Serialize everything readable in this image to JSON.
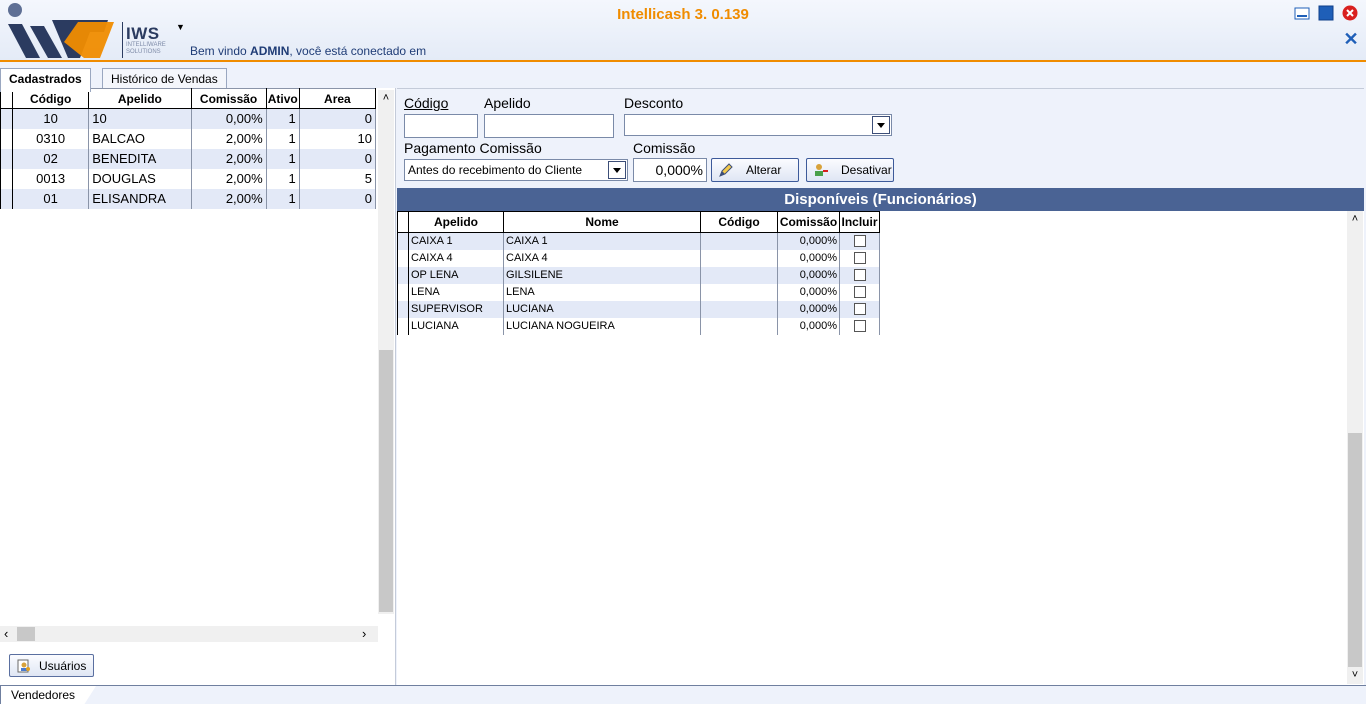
{
  "app": {
    "title": "Intellicash 3. 0.139",
    "logo_text": "IWS",
    "logo_subtitle": "INTELLIWARE SOLUTIONS",
    "welcome_prefix": "Bem vindo ",
    "welcome_user": "ADMIN",
    "welcome_suffix": ", você está conectado em",
    "accent_color": "#f08c00",
    "brand_color": "#4a6394"
  },
  "tabs": [
    {
      "label": "Cadastrados",
      "active": true
    },
    {
      "label": "Histórico de Vendas",
      "active": false
    }
  ],
  "left_table": {
    "columns": [
      "Código",
      "Apelido",
      "Comissão",
      "Ativo",
      "Area"
    ],
    "rows": [
      {
        "codigo": "10",
        "apelido": "10",
        "comissao": "0,00%",
        "ativo": "1",
        "area": "0"
      },
      {
        "codigo": "0310",
        "apelido": "BALCAO",
        "comissao": "2,00%",
        "ativo": "1",
        "area": "10"
      },
      {
        "codigo": "02",
        "apelido": "BENEDITA",
        "comissao": "2,00%",
        "ativo": "1",
        "area": "0"
      },
      {
        "codigo": "0013",
        "apelido": "DOUGLAS",
        "comissao": "2,00%",
        "ativo": "1",
        "area": "5"
      },
      {
        "codigo": "01",
        "apelido": "ELISANDRA",
        "comissao": "2,00%",
        "ativo": "1",
        "area": "0"
      }
    ]
  },
  "usuarios_button": {
    "label": "Usuários"
  },
  "form": {
    "codigo_label": "Código",
    "codigo_value": "",
    "apelido_label": "Apelido",
    "apelido_value": "",
    "desconto_label": "Desconto",
    "desconto_value": "",
    "pagamento_label": "Pagamento Comissão",
    "pagamento_value": "Antes do recebimento do Cliente",
    "comissao_label": "Comissão",
    "comissao_value": "0,000%",
    "alterar_label": "Alterar",
    "desativar_label": "Desativar"
  },
  "disponiveis": {
    "title": "Disponíveis (Funcionários)",
    "columns": [
      "Apelido",
      "Nome",
      "Código",
      "Comissão",
      "Incluir"
    ],
    "rows": [
      {
        "apelido": "CAIXA 1",
        "nome": "CAIXA 1",
        "codigo": "",
        "comissao": "0,000%",
        "incluir": false
      },
      {
        "apelido": "CAIXA 4",
        "nome": "CAIXA 4",
        "codigo": "",
        "comissao": "0,000%",
        "incluir": false
      },
      {
        "apelido": "OP LENA",
        "nome": "GILSILENE",
        "codigo": "",
        "comissao": "0,000%",
        "incluir": false
      },
      {
        "apelido": "LENA",
        "nome": "LENA",
        "codigo": "",
        "comissao": "0,000%",
        "incluir": false
      },
      {
        "apelido": "SUPERVISOR",
        "nome": "LUCIANA",
        "codigo": "",
        "comissao": "0,000%",
        "incluir": false
      },
      {
        "apelido": "LUCIANA",
        "nome": "LUCIANA NOGUEIRA",
        "codigo": "",
        "comissao": "0,000%",
        "incluir": false
      }
    ]
  },
  "bottom_tab": {
    "label": "Vendedores"
  }
}
